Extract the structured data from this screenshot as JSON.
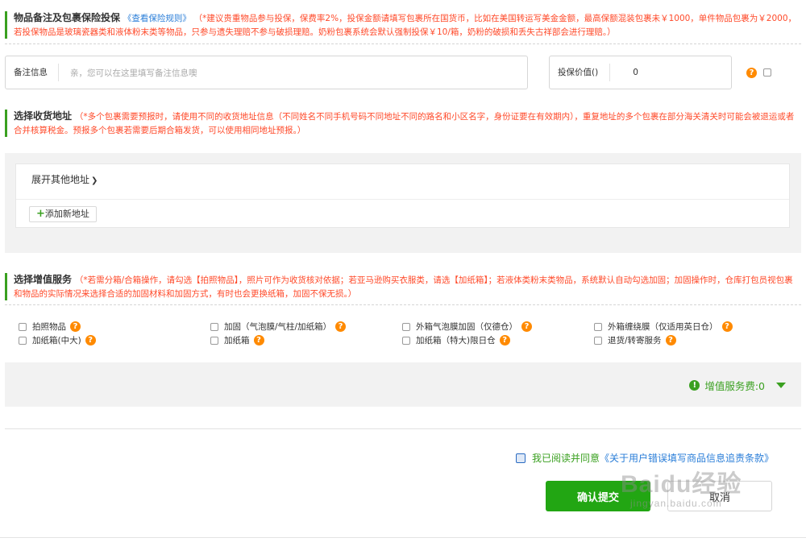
{
  "insurance": {
    "title": "物品备注及包裹保险投保",
    "rules_link": "《查看保险规则》",
    "note_line1": "（*建议贵重物品参与投保，保费率2%，投保金额请填写包裹所在国货币，比如在美国转运写美金金额，最高保额混装包裹未￥1000，单件物品包裹为￥2000，",
    "note_line2": "若投保物品是玻璃瓷器类和液体粉末类等物品，只参与遗失理赔不参与破损理赔。奶粉包裹系统会默认强制投保￥10/箱，奶粉的破损和丢失古祥部会进行理赔。）",
    "remark_label": "备注信息",
    "remark_placeholder": "亲，您可以在这里填写备注信息噢",
    "value_label": "投保价值()",
    "value": "0"
  },
  "address": {
    "title": "选择收货地址",
    "note_line1": "（*多个包裹需要预报时，请使用不同的收货地址信息（不同姓名不同手机号码不同地址不同的路名和小区名字，身份证要在有效期内），重复地址的多个包裹在部分海关清关时可能会被退运或者",
    "note_line2": "合并核算税金。预报多个包裹若需要后期合箱发货，可以使用相同地址预报。）",
    "expand_label": "展开其他地址",
    "add_label": "添加新地址"
  },
  "services": {
    "title": "选择增值服务",
    "note_line1": "（*若需分箱/合箱操作，请勾选【拍照物品】，照片可作为收货核对依据；若亚马逊购买衣服类，请选【加纸箱】；若液体类粉末类物品，系统默认自动勾选加固；加固操作时，仓库打包员视包裹",
    "note_line2": "和物品的实际情况来选择合适的加固材料和加固方式，有时也会更换纸箱，加固不保无损。）",
    "items": [
      {
        "label": "拍照物品"
      },
      {
        "label": "加固（气泡膜/气柱/加纸箱）"
      },
      {
        "label": "外箱气泡膜加固（仅德仓）"
      },
      {
        "label": "外箱缠绕膜（仅适用英日仓）"
      },
      {
        "label": "加纸箱(中大)"
      },
      {
        "label": "加纸箱"
      },
      {
        "label": "加纸箱（特大)限日仓"
      },
      {
        "label": "退货/转寄服务"
      }
    ],
    "fee_label": "增值服务费:0"
  },
  "footer": {
    "agree_text": "我已阅读并同意",
    "terms_text": "《关于用户错误填写商品信息追责条款》",
    "submit_label": "确认提交",
    "cancel_label": "取消"
  },
  "watermark": {
    "main": "Baidu经验",
    "sub": "jingyan.baidu.com"
  },
  "icons": {
    "help": "question-circle-icon",
    "fee": "exclamation-circle-icon",
    "expand": "chevron-down-icon",
    "add": "plus-icon",
    "fee_toggle": "caret-down-icon"
  },
  "colors": {
    "accent_green": "#22a613",
    "note_red": "#ff4a2a",
    "link_blue": "#2a7ed8",
    "help_orange": "#ff8a00"
  }
}
